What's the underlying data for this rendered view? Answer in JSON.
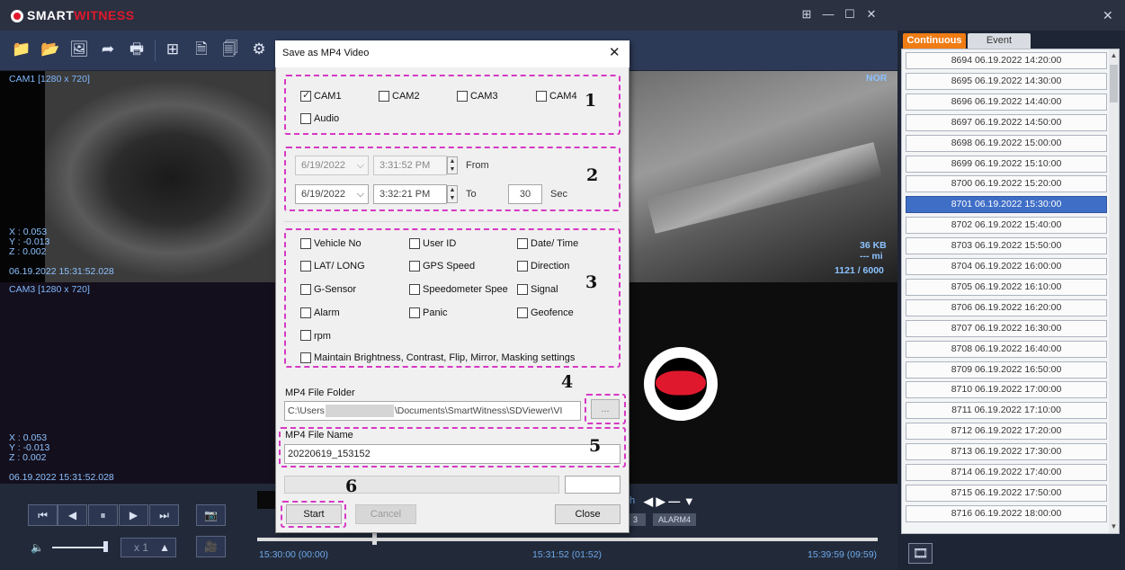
{
  "app": {
    "logo_brand": "SMART",
    "logo_accent": "WITNESS",
    "window_controls": [
      "⊞",
      "—",
      "☐",
      "✕"
    ]
  },
  "cameras": {
    "cam1_label": "CAM1 [1280 x 720]",
    "cam1_coords": [
      "X :  0.053",
      "Y : -0.013",
      "Z :  0.002"
    ],
    "cam1_time": "06.19.2022 15:31:52.028",
    "cam2_mode": "NOR",
    "cam2_size": "36 KB",
    "cam2_extra": "--- mi",
    "cam2_frames": "1121 / 6000",
    "cam3_label": "CAM3 [1280 x 720]",
    "cam3_coords": [
      "X :  0.053",
      "Y : -0.013",
      "Z :  0.002"
    ],
    "cam3_time": "06.19.2022 15:31:52.028"
  },
  "timeline": {
    "start": "15:30:00 (00:00)",
    "current": "15:31:52 (01:52)",
    "end": "15:39:59 (09:59)",
    "speed": "x 1",
    "alarm_tags": [
      "3",
      "ALARM4"
    ],
    "nav_arrows": "◀ ▶ — ▼",
    "stub_h": "h"
  },
  "side": {
    "tab_continuous": "Continuous",
    "tab_event": "Event",
    "records": [
      "8694  06.19.2022 14:20:00",
      "8695  06.19.2022 14:30:00",
      "8696  06.19.2022 14:40:00",
      "8697  06.19.2022 14:50:00",
      "8698  06.19.2022 15:00:00",
      "8699  06.19.2022 15:10:00",
      "8700  06.19.2022 15:20:00",
      "8701  06.19.2022 15:30:00",
      "8702  06.19.2022 15:40:00",
      "8703  06.19.2022 15:50:00",
      "8704  06.19.2022 16:00:00",
      "8705  06.19.2022 16:10:00",
      "8706  06.19.2022 16:20:00",
      "8707  06.19.2022 16:30:00",
      "8708  06.19.2022 16:40:00",
      "8709  06.19.2022 16:50:00",
      "8710  06.19.2022 17:00:00",
      "8711  06.19.2022 17:10:00",
      "8712  06.19.2022 17:20:00",
      "8713  06.19.2022 17:30:00",
      "8714  06.19.2022 17:40:00",
      "8715  06.19.2022 17:50:00",
      "8716  06.19.2022 18:00:00"
    ],
    "selected_record": "8701  06.19.2022 15:30:00"
  },
  "dialog": {
    "title": "Save as MP4 Video",
    "cameras": {
      "cam1": "CAM1",
      "cam2": "CAM2",
      "cam3": "CAM3",
      "cam4": "CAM4",
      "audio": "Audio"
    },
    "time": {
      "from_date": "6/19/2022",
      "from_time": "3:31:52 PM",
      "from_label": "From",
      "to_date": "6/19/2022",
      "to_time": "3:32:21 PM",
      "to_label": "To",
      "duration": "30",
      "duration_unit": "Sec"
    },
    "overlays": {
      "vehicle_no": "Vehicle No",
      "user_id": "User ID",
      "date_time": "Date/ Time",
      "lat_long": "LAT/ LONG",
      "gps_speed": "GPS Speed",
      "direction": "Direction",
      "g_sensor": "G-Sensor",
      "speedometer": "Speedometer Spee",
      "signal": "Signal",
      "alarm": "Alarm",
      "panic": "Panic",
      "geofence": "Geofence",
      "rpm": "rpm",
      "maintain": "Maintain Brightness, Contrast, Flip, Mirror, Masking settings"
    },
    "folder": {
      "label": "MP4 File Folder",
      "value_prefix": "C:\\Users",
      "value_suffix": "\\Documents\\SmartWitness\\SDViewer\\VI",
      "browse": "..."
    },
    "file": {
      "label": "MP4 File Name",
      "value": "20220619_153152"
    },
    "buttons": {
      "start": "Start",
      "cancel": "Cancel",
      "close": "Close"
    },
    "step_numbers": [
      "1",
      "2",
      "3",
      "4",
      "5",
      "6"
    ]
  }
}
